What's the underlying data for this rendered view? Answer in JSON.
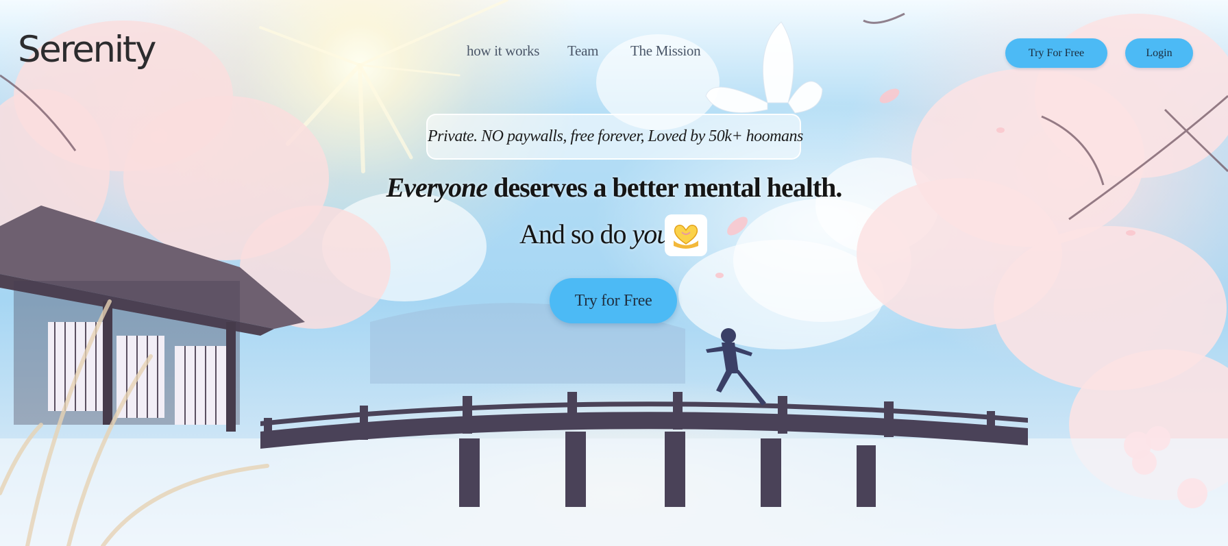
{
  "brand": {
    "name": "Serenity"
  },
  "nav": {
    "items": [
      {
        "label": "how it works"
      },
      {
        "label": "Team"
      },
      {
        "label": "The Mission"
      }
    ]
  },
  "header": {
    "try_label": "Try For Free",
    "login_label": "Login"
  },
  "hero": {
    "tagline": "Private. NO paywalls, free forever, Loved by 50k+ hoomans",
    "headline_em": "Everyone",
    "headline_rest": " deserves a better mental health.",
    "subline_start": "And so do ",
    "subline_em": "you!",
    "emoji_icon": "heart-hands-icon",
    "cta_label": "Try for Free"
  },
  "colors": {
    "accent": "#4cbaf5",
    "text_dark": "#151515",
    "nav_text": "#4a5668",
    "sky": "#a6d6f3"
  }
}
